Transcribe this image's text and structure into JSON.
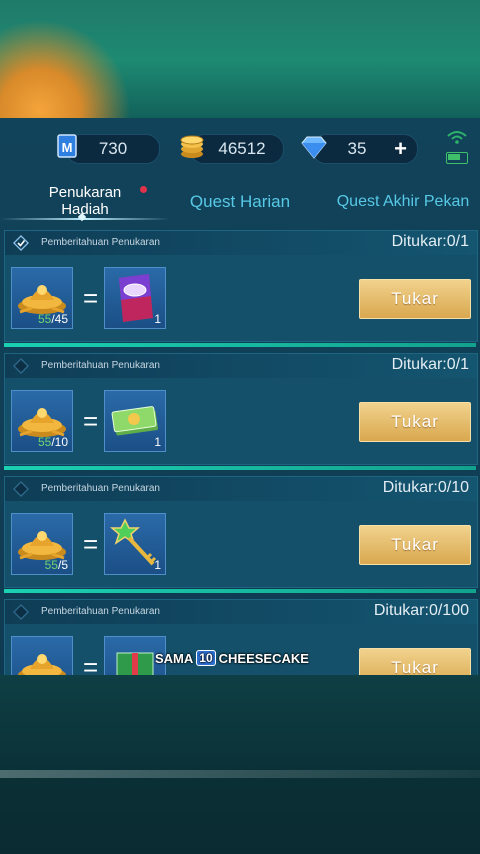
{
  "currency": {
    "token": "730",
    "gold": "46512",
    "diamond": "35",
    "add_label": "+"
  },
  "tabs": [
    {
      "label_line1": "Penukaran",
      "label_line2": "Hadiah"
    },
    {
      "label": "Quest Harian"
    },
    {
      "label": "Quest Akhir Pekan"
    }
  ],
  "cards": [
    {
      "notice": "Pemberitahuan Penukaran",
      "redeemed": "Ditukar:0/1",
      "cost_have": "55",
      "cost_need": "/45",
      "reward_qty": "1",
      "reward_icon": "ticket-card-icon",
      "button": "Tukar"
    },
    {
      "notice": "Pemberitahuan Penukaran",
      "redeemed": "Ditukar:0/1",
      "cost_have": "55",
      "cost_need": "/10",
      "reward_qty": "1",
      "reward_icon": "cash-bundle-icon",
      "button": "Tukar"
    },
    {
      "notice": "Pemberitahuan Penukaran",
      "redeemed": "Ditukar:0/10",
      "cost_have": "55",
      "cost_need": "/5",
      "reward_qty": "1",
      "reward_icon": "star-key-icon",
      "button": "Tukar"
    },
    {
      "notice": "Pemberitahuan Penukaran",
      "redeemed": "Ditukar:0/100",
      "reward_icon": "gift-box-icon",
      "button": "Tukar"
    }
  ],
  "caption": {
    "part1": "SAMA",
    "num": "10",
    "part2": "CHEESECAKE"
  },
  "colors": {
    "panel": "#11435a",
    "button_gold": "#d9a84f",
    "tab_inactive": "#57c9e6",
    "have_green": "#6fd46f"
  }
}
